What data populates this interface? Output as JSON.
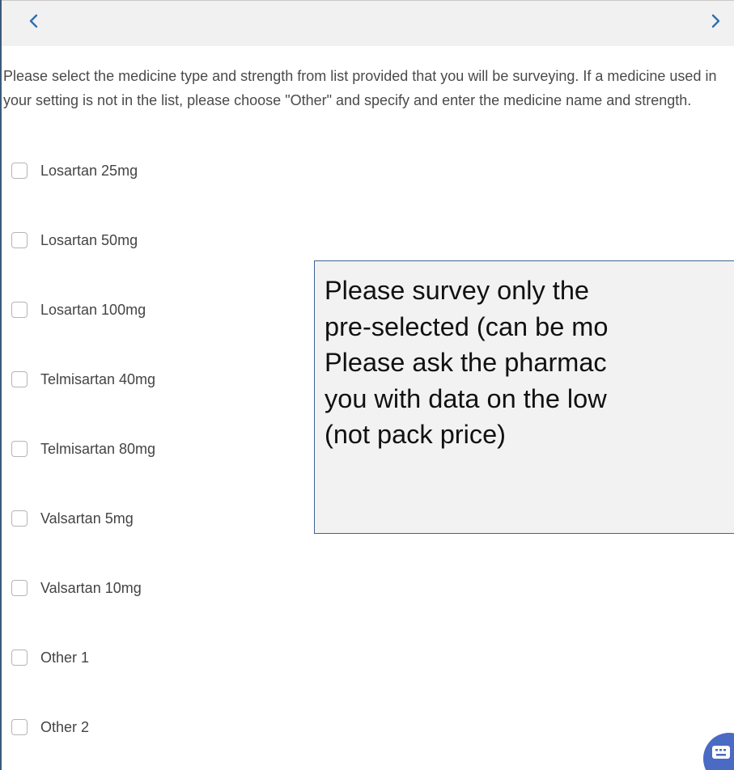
{
  "nav": {
    "prev_icon": "chevron-left-icon",
    "next_icon": "chevron-right-icon",
    "accent_color": "#2f6fb0"
  },
  "instructions": {
    "text": "Please select the medicine type and strength from list provided that you will be surveying. If a medicine used in your setting is not in the list, please choose \"Other\" and specify and enter the medicine name and strength."
  },
  "options": [
    {
      "label": "Losartan 25mg",
      "checked": false
    },
    {
      "label": "Losartan 50mg",
      "checked": false
    },
    {
      "label": "Losartan 100mg",
      "checked": false
    },
    {
      "label": "Telmisartan 40mg",
      "checked": false
    },
    {
      "label": "Telmisartan 80mg",
      "checked": false
    },
    {
      "label": "Valsartan 5mg",
      "checked": false
    },
    {
      "label": "Valsartan 10mg",
      "checked": false
    },
    {
      "label": "Other 1",
      "checked": false
    },
    {
      "label": "Other 2",
      "checked": false
    }
  ],
  "callout": {
    "lines": [
      "Please survey only the",
      "pre-selected (can be mo",
      "Please ask the pharmac",
      "you with data on the low",
      "(not pack price)"
    ]
  },
  "fab": {
    "icon": "keyboard-icon",
    "color": "#4a6ac4"
  }
}
